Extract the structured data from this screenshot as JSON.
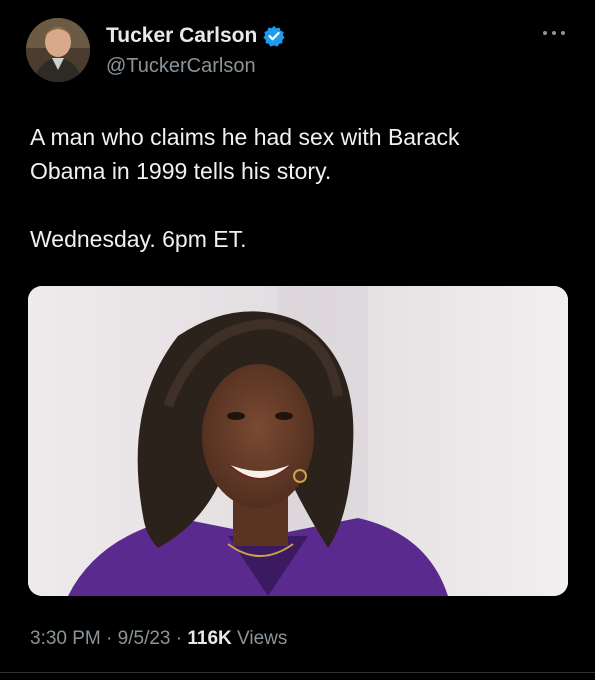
{
  "author": {
    "display_name": "Tucker Carlson",
    "handle": "@TuckerCarlson",
    "verified": true
  },
  "tweet": {
    "line1": "A man who claims he had sex with Barack",
    "line2": "Obama in 1999 tells his story.",
    "line3": "Wednesday. 6pm ET."
  },
  "meta": {
    "time": "3:30 PM",
    "sep1": "·",
    "date": "9/5/23",
    "sep2": "·",
    "views_count": "116K",
    "views_label": "Views"
  },
  "colors": {
    "background": "#000000",
    "text": "#e7e9ea",
    "muted": "#8b949a",
    "verified": "#1d9bf0"
  },
  "icons": {
    "verified": "verified-badge-icon",
    "more": "more-options-icon"
  }
}
